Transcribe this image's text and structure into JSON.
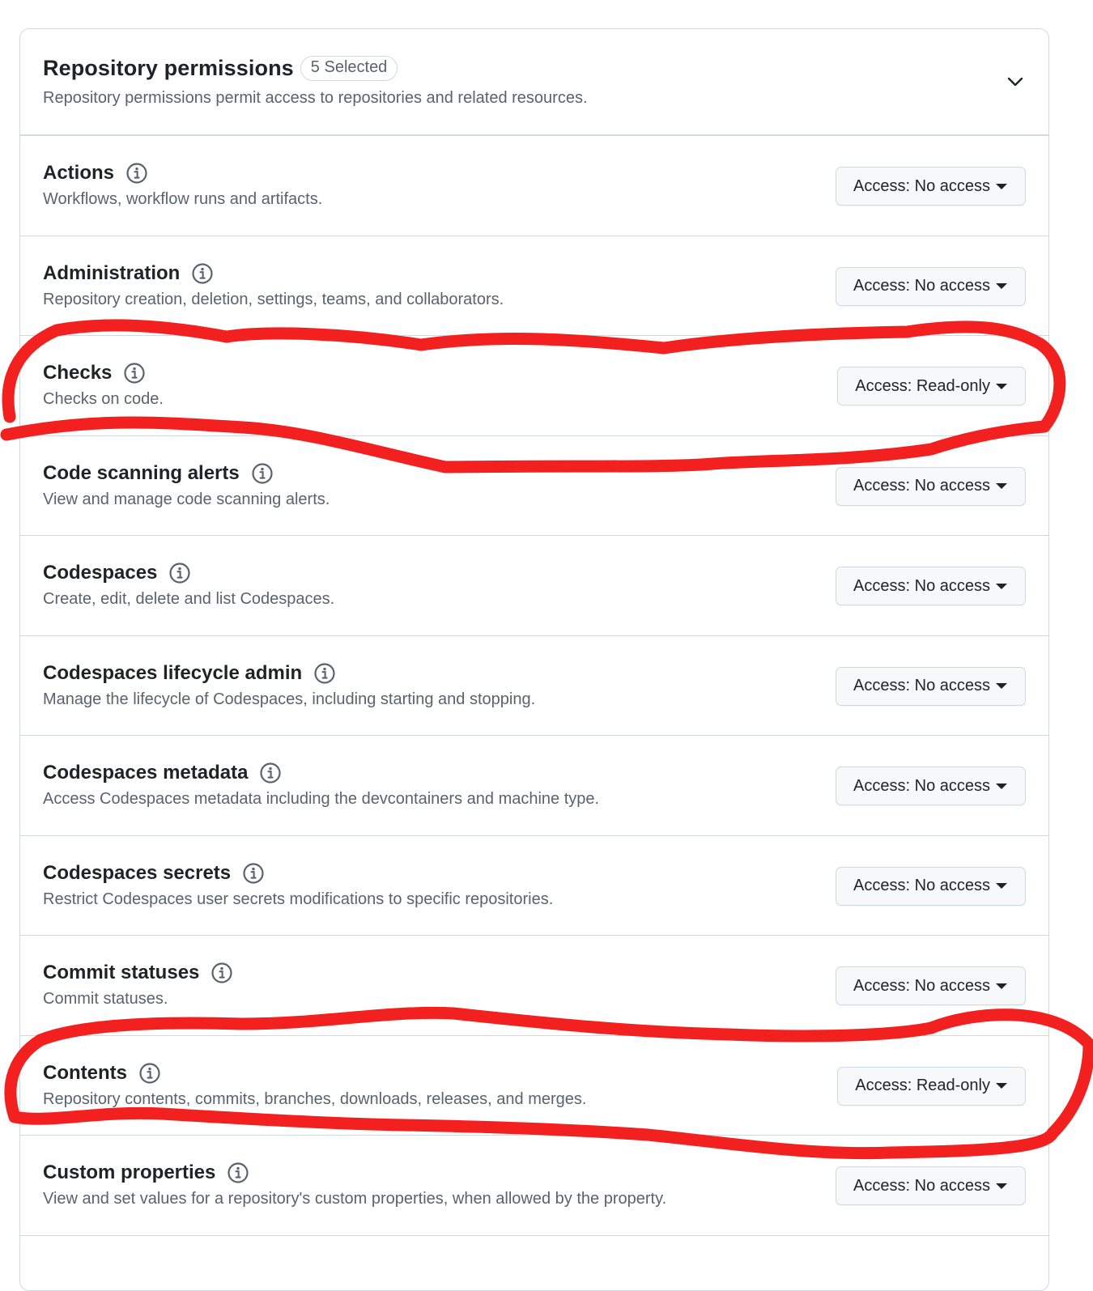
{
  "header": {
    "title": "Repository permissions",
    "badge": "5 Selected",
    "description": "Repository permissions permit access to repositories and related resources."
  },
  "permissions": [
    {
      "title": "Actions",
      "description": "Workflows, workflow runs and artifacts.",
      "access": "Access: No access"
    },
    {
      "title": "Administration",
      "description": "Repository creation, deletion, settings, teams, and collaborators.",
      "access": "Access: No access"
    },
    {
      "title": "Checks",
      "description": "Checks on code.",
      "access": "Access: Read-only"
    },
    {
      "title": "Code scanning alerts",
      "description": "View and manage code scanning alerts.",
      "access": "Access: No access"
    },
    {
      "title": "Codespaces",
      "description": "Create, edit, delete and list Codespaces.",
      "access": "Access: No access"
    },
    {
      "title": "Codespaces lifecycle admin",
      "description": "Manage the lifecycle of Codespaces, including starting and stopping.",
      "access": "Access: No access"
    },
    {
      "title": "Codespaces metadata",
      "description": "Access Codespaces metadata including the devcontainers and machine type.",
      "access": "Access: No access"
    },
    {
      "title": "Codespaces secrets",
      "description": "Restrict Codespaces user secrets modifications to specific repositories.",
      "access": "Access: No access"
    },
    {
      "title": "Commit statuses",
      "description": "Commit statuses.",
      "access": "Access: No access"
    },
    {
      "title": "Contents",
      "description": "Repository contents, commits, branches, downloads, releases, and merges.",
      "access": "Access: Read-only"
    },
    {
      "title": "Custom properties",
      "description": "View and set values for a repository's custom properties, when allowed by the property.",
      "access": "Access: No access"
    }
  ],
  "icons": {
    "info": "info-icon",
    "chevron": "chevron-down-icon",
    "caret": "caret-down-icon"
  },
  "colors": {
    "annotation": "#f32020",
    "border": "#d1d9e0",
    "muted_text": "#59636e"
  }
}
